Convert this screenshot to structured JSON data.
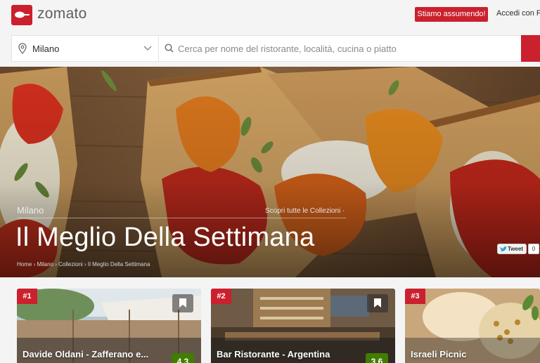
{
  "header": {
    "logo_text": "zomato",
    "hiring_label": "Stiamo assumendo!",
    "login_label": "Accedi con Fa"
  },
  "search": {
    "city": "Milano",
    "placeholder": "Cerca per nome del ristorante, località, cucina o piatto"
  },
  "hero": {
    "city": "Milano",
    "collections_link": "Scopri tutte le Collezioni ·",
    "title": "Il Meglio Della Settimana",
    "breadcrumb": "Home › Milano › Collezioni › Il Meglio Della Settimana",
    "tweet_label": "Tweet",
    "tweet_count": "0"
  },
  "cards": [
    {
      "rank": "#1",
      "name": "Davide Oldani - Zafferano e...",
      "rating": "4.3"
    },
    {
      "rank": "#2",
      "name": "Bar Ristorante - Argentina",
      "rating": "3.6"
    },
    {
      "rank": "#3",
      "name": "Israeli Picnic",
      "rating": ""
    }
  ],
  "colors": {
    "brand_red": "#cb202d",
    "rating_green": "#3f7e00"
  },
  "icons": [
    "location-pin-icon",
    "chevron-down-icon",
    "search-icon",
    "bookmark-icon",
    "twitter-bird-icon"
  ]
}
